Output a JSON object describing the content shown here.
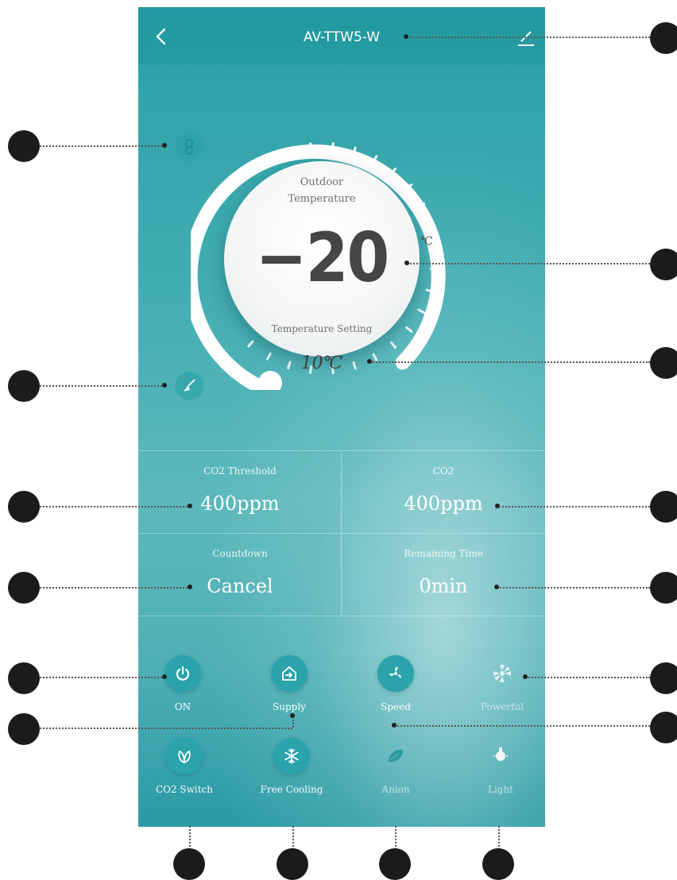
{
  "header": {
    "title": "AV-TTW5-W",
    "back_icon": "chevron-left-icon",
    "edit_icon": "pencil-icon"
  },
  "side_icons": {
    "top": "link-icon",
    "bottom": "broom-icon"
  },
  "dial": {
    "outdoor_label_line1": "Outdoor",
    "outdoor_label_line2": "Temperature",
    "outdoor_temp": "−20",
    "unit": "℃",
    "setting_label": "Temperature Setting",
    "setting_value": "10℃"
  },
  "grid": [
    {
      "label": "CO2 Threshold",
      "value": "400ppm"
    },
    {
      "label": "CO2",
      "value": "400ppm"
    },
    {
      "label": "Countdown",
      "value": "Cancel"
    },
    {
      "label": "Remaining Time",
      "value": "0min"
    }
  ],
  "buttons": [
    {
      "label": "ON",
      "icon": "power-icon",
      "active": true
    },
    {
      "label": "Supply",
      "icon": "supply-icon",
      "active": true
    },
    {
      "label": "Speed",
      "icon": "fan-icon",
      "active": true
    },
    {
      "label": "Powerful",
      "icon": "turbo-icon",
      "active": false
    },
    {
      "label": "CO2 Switch",
      "icon": "leaf-icon",
      "active": true
    },
    {
      "label": "Free Cooling",
      "icon": "snowflake-icon",
      "active": true
    },
    {
      "label": "Anion",
      "icon": "anion-leaf-icon",
      "active": false
    },
    {
      "label": "Light",
      "icon": "bulb-icon",
      "active": false
    }
  ],
  "colors": {
    "background_teal": "#43aeb3",
    "active_button": "#2aa3aa",
    "callout": "#1b1b1b"
  }
}
